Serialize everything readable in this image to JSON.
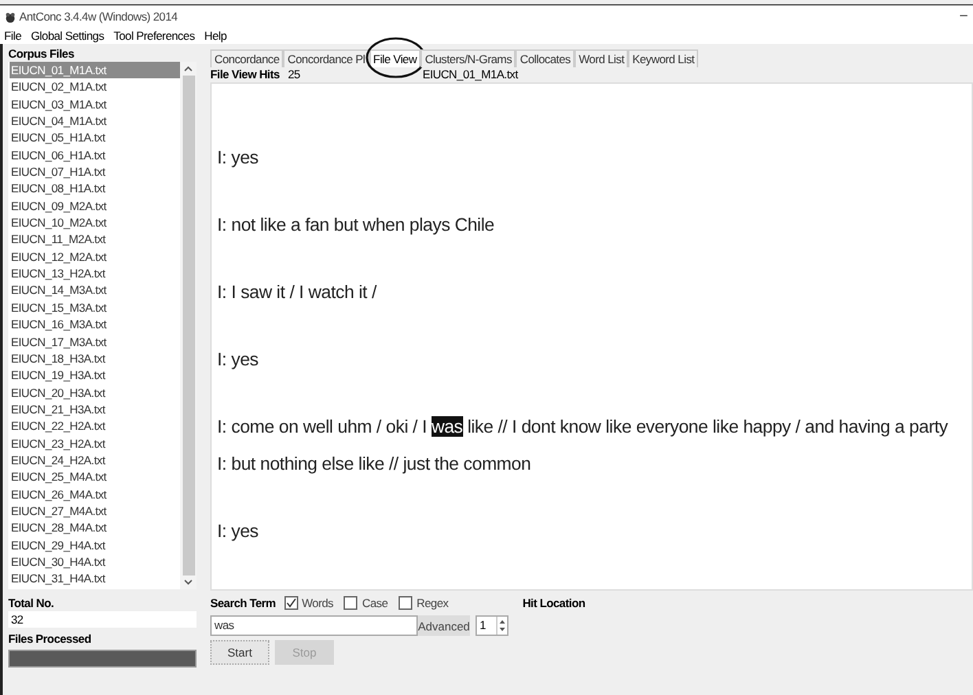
{
  "window": {
    "title": "AntConc 3.4.4w (Windows) 2014",
    "minimize": "−"
  },
  "menu": [
    "File",
    "Global Settings",
    "Tool Preferences",
    "Help"
  ],
  "corpus": {
    "heading": "Corpus Files",
    "files": [
      {
        "name": "EIUCN_01_M1A.txt",
        "selected": true
      },
      {
        "name": "EIUCN_02_M1A.txt",
        "selected": false
      },
      {
        "name": "EIUCN_03_M1A.txt",
        "selected": false
      },
      {
        "name": "EIUCN_04_M1A.txt",
        "selected": false
      },
      {
        "name": "EIUCN_05_H1A.txt",
        "selected": false
      },
      {
        "name": "EIUCN_06_H1A.txt",
        "selected": false
      },
      {
        "name": "EIUCN_07_H1A.txt",
        "selected": false
      },
      {
        "name": "EIUCN_08_H1A.txt",
        "selected": false
      },
      {
        "name": "EIUCN_09_M2A.txt",
        "selected": false
      },
      {
        "name": "EIUCN_10_M2A.txt",
        "selected": false
      },
      {
        "name": "EIUCN_11_M2A.txt",
        "selected": false
      },
      {
        "name": "EIUCN_12_M2A.txt",
        "selected": false
      },
      {
        "name": "EIUCN_13_H2A.txt",
        "selected": false
      },
      {
        "name": "EIUCN_14_M3A.txt",
        "selected": false
      },
      {
        "name": "EIUCN_15_M3A.txt",
        "selected": false
      },
      {
        "name": "EIUCN_16_M3A.txt",
        "selected": false
      },
      {
        "name": "EIUCN_17_M3A.txt",
        "selected": false
      },
      {
        "name": "EIUCN_18_H3A.txt",
        "selected": false
      },
      {
        "name": "EIUCN_19_H3A.txt",
        "selected": false
      },
      {
        "name": "EIUCN_20_H3A.txt",
        "selected": false
      },
      {
        "name": "EIUCN_21_H3A.txt",
        "selected": false
      },
      {
        "name": "EIUCN_22_H2A.txt",
        "selected": false
      },
      {
        "name": "EIUCN_23_H2A.txt",
        "selected": false
      },
      {
        "name": "EIUCN_24_H2A.txt",
        "selected": false
      },
      {
        "name": "EIUCN_25_M4A.txt",
        "selected": false
      },
      {
        "name": "EIUCN_26_M4A.txt",
        "selected": false
      },
      {
        "name": "EIUCN_27_M4A.txt",
        "selected": false
      },
      {
        "name": "EIUCN_28_M4A.txt",
        "selected": false
      },
      {
        "name": "EIUCN_29_H4A.txt",
        "selected": false
      },
      {
        "name": "EIUCN_30_H4A.txt",
        "selected": false
      },
      {
        "name": "EIUCN_31_H4A.txt",
        "selected": false
      }
    ],
    "total_label": "Total No.",
    "total_value": "32",
    "processed_label": "Files Processed",
    "progress": {
      "level": 1
    }
  },
  "tabs": [
    {
      "label": "Concordance",
      "selected": false
    },
    {
      "label": "Concordance Pl",
      "selected": false
    },
    {
      "label": "File View",
      "selected": true,
      "circled": true
    },
    {
      "label": "Clusters/N-Grams",
      "selected": false
    },
    {
      "label": "Collocates",
      "selected": false
    },
    {
      "label": "Word List",
      "selected": false
    },
    {
      "label": "Keyword List",
      "selected": false
    }
  ],
  "file_view": {
    "hits_label": "File View Hits",
    "hits_value": "25",
    "file_value": "EIUCN_01_M1A.txt",
    "blocks": [
      [
        [
          {
            "text": "I: yes",
            "highlighted": false
          }
        ]
      ],
      [
        [
          {
            "text": "I: not like a fan but when plays Chile",
            "highlighted": false
          }
        ]
      ],
      [
        [
          {
            "text": "I: I saw it / I watch it /",
            "highlighted": false
          }
        ]
      ],
      [
        [
          {
            "text": "I: yes",
            "highlighted": false
          }
        ]
      ],
      [
        [
          {
            "text": "I: come on  well  uhm / oki / I ",
            "highlighted": false
          },
          {
            "text": "was",
            "highlighted": true
          },
          {
            "text": " like // I dont know like everyone like happy / and having a party",
            "highlighted": false
          }
        ],
        [
          {
            "text": "I: but nothing else like // just the common",
            "highlighted": false
          }
        ]
      ],
      [
        [
          {
            "text": "I: yes",
            "highlighted": false
          }
        ]
      ]
    ]
  },
  "search": {
    "label": "Search Term",
    "options": [
      {
        "label": "Words",
        "checked": true
      },
      {
        "label": "Case",
        "checked": false
      },
      {
        "label": "Regex",
        "checked": false
      }
    ],
    "value": "was",
    "advanced": "Advanced",
    "hit_location_label": "Hit Location",
    "hit_location": "1",
    "buttons": [
      {
        "label": "Start",
        "disabled": false
      },
      {
        "label": "Stop",
        "disabled": true
      }
    ]
  }
}
